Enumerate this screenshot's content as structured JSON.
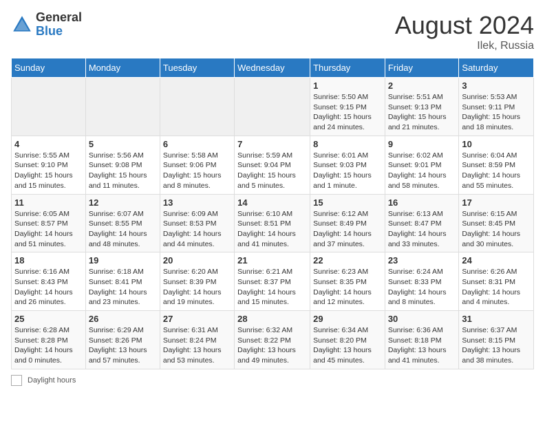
{
  "header": {
    "logo_general": "General",
    "logo_blue": "Blue",
    "month_title": "August 2024",
    "location": "Ilek, Russia"
  },
  "weekdays": [
    "Sunday",
    "Monday",
    "Tuesday",
    "Wednesday",
    "Thursday",
    "Friday",
    "Saturday"
  ],
  "footer": {
    "label": "Daylight hours"
  },
  "weeks": [
    [
      {
        "day": "",
        "sunrise": "",
        "sunset": "",
        "daylight": ""
      },
      {
        "day": "",
        "sunrise": "",
        "sunset": "",
        "daylight": ""
      },
      {
        "day": "",
        "sunrise": "",
        "sunset": "",
        "daylight": ""
      },
      {
        "day": "",
        "sunrise": "",
        "sunset": "",
        "daylight": ""
      },
      {
        "day": "1",
        "sunrise": "Sunrise: 5:50 AM",
        "sunset": "Sunset: 9:15 PM",
        "daylight": "Daylight: 15 hours and 24 minutes."
      },
      {
        "day": "2",
        "sunrise": "Sunrise: 5:51 AM",
        "sunset": "Sunset: 9:13 PM",
        "daylight": "Daylight: 15 hours and 21 minutes."
      },
      {
        "day": "3",
        "sunrise": "Sunrise: 5:53 AM",
        "sunset": "Sunset: 9:11 PM",
        "daylight": "Daylight: 15 hours and 18 minutes."
      }
    ],
    [
      {
        "day": "4",
        "sunrise": "Sunrise: 5:55 AM",
        "sunset": "Sunset: 9:10 PM",
        "daylight": "Daylight: 15 hours and 15 minutes."
      },
      {
        "day": "5",
        "sunrise": "Sunrise: 5:56 AM",
        "sunset": "Sunset: 9:08 PM",
        "daylight": "Daylight: 15 hours and 11 minutes."
      },
      {
        "day": "6",
        "sunrise": "Sunrise: 5:58 AM",
        "sunset": "Sunset: 9:06 PM",
        "daylight": "Daylight: 15 hours and 8 minutes."
      },
      {
        "day": "7",
        "sunrise": "Sunrise: 5:59 AM",
        "sunset": "Sunset: 9:04 PM",
        "daylight": "Daylight: 15 hours and 5 minutes."
      },
      {
        "day": "8",
        "sunrise": "Sunrise: 6:01 AM",
        "sunset": "Sunset: 9:03 PM",
        "daylight": "Daylight: 15 hours and 1 minute."
      },
      {
        "day": "9",
        "sunrise": "Sunrise: 6:02 AM",
        "sunset": "Sunset: 9:01 PM",
        "daylight": "Daylight: 14 hours and 58 minutes."
      },
      {
        "day": "10",
        "sunrise": "Sunrise: 6:04 AM",
        "sunset": "Sunset: 8:59 PM",
        "daylight": "Daylight: 14 hours and 55 minutes."
      }
    ],
    [
      {
        "day": "11",
        "sunrise": "Sunrise: 6:05 AM",
        "sunset": "Sunset: 8:57 PM",
        "daylight": "Daylight: 14 hours and 51 minutes."
      },
      {
        "day": "12",
        "sunrise": "Sunrise: 6:07 AM",
        "sunset": "Sunset: 8:55 PM",
        "daylight": "Daylight: 14 hours and 48 minutes."
      },
      {
        "day": "13",
        "sunrise": "Sunrise: 6:09 AM",
        "sunset": "Sunset: 8:53 PM",
        "daylight": "Daylight: 14 hours and 44 minutes."
      },
      {
        "day": "14",
        "sunrise": "Sunrise: 6:10 AM",
        "sunset": "Sunset: 8:51 PM",
        "daylight": "Daylight: 14 hours and 41 minutes."
      },
      {
        "day": "15",
        "sunrise": "Sunrise: 6:12 AM",
        "sunset": "Sunset: 8:49 PM",
        "daylight": "Daylight: 14 hours and 37 minutes."
      },
      {
        "day": "16",
        "sunrise": "Sunrise: 6:13 AM",
        "sunset": "Sunset: 8:47 PM",
        "daylight": "Daylight: 14 hours and 33 minutes."
      },
      {
        "day": "17",
        "sunrise": "Sunrise: 6:15 AM",
        "sunset": "Sunset: 8:45 PM",
        "daylight": "Daylight: 14 hours and 30 minutes."
      }
    ],
    [
      {
        "day": "18",
        "sunrise": "Sunrise: 6:16 AM",
        "sunset": "Sunset: 8:43 PM",
        "daylight": "Daylight: 14 hours and 26 minutes."
      },
      {
        "day": "19",
        "sunrise": "Sunrise: 6:18 AM",
        "sunset": "Sunset: 8:41 PM",
        "daylight": "Daylight: 14 hours and 23 minutes."
      },
      {
        "day": "20",
        "sunrise": "Sunrise: 6:20 AM",
        "sunset": "Sunset: 8:39 PM",
        "daylight": "Daylight: 14 hours and 19 minutes."
      },
      {
        "day": "21",
        "sunrise": "Sunrise: 6:21 AM",
        "sunset": "Sunset: 8:37 PM",
        "daylight": "Daylight: 14 hours and 15 minutes."
      },
      {
        "day": "22",
        "sunrise": "Sunrise: 6:23 AM",
        "sunset": "Sunset: 8:35 PM",
        "daylight": "Daylight: 14 hours and 12 minutes."
      },
      {
        "day": "23",
        "sunrise": "Sunrise: 6:24 AM",
        "sunset": "Sunset: 8:33 PM",
        "daylight": "Daylight: 14 hours and 8 minutes."
      },
      {
        "day": "24",
        "sunrise": "Sunrise: 6:26 AM",
        "sunset": "Sunset: 8:31 PM",
        "daylight": "Daylight: 14 hours and 4 minutes."
      }
    ],
    [
      {
        "day": "25",
        "sunrise": "Sunrise: 6:28 AM",
        "sunset": "Sunset: 8:28 PM",
        "daylight": "Daylight: 14 hours and 0 minutes."
      },
      {
        "day": "26",
        "sunrise": "Sunrise: 6:29 AM",
        "sunset": "Sunset: 8:26 PM",
        "daylight": "Daylight: 13 hours and 57 minutes."
      },
      {
        "day": "27",
        "sunrise": "Sunrise: 6:31 AM",
        "sunset": "Sunset: 8:24 PM",
        "daylight": "Daylight: 13 hours and 53 minutes."
      },
      {
        "day": "28",
        "sunrise": "Sunrise: 6:32 AM",
        "sunset": "Sunset: 8:22 PM",
        "daylight": "Daylight: 13 hours and 49 minutes."
      },
      {
        "day": "29",
        "sunrise": "Sunrise: 6:34 AM",
        "sunset": "Sunset: 8:20 PM",
        "daylight": "Daylight: 13 hours and 45 minutes."
      },
      {
        "day": "30",
        "sunrise": "Sunrise: 6:36 AM",
        "sunset": "Sunset: 8:18 PM",
        "daylight": "Daylight: 13 hours and 41 minutes."
      },
      {
        "day": "31",
        "sunrise": "Sunrise: 6:37 AM",
        "sunset": "Sunset: 8:15 PM",
        "daylight": "Daylight: 13 hours and 38 minutes."
      }
    ]
  ]
}
